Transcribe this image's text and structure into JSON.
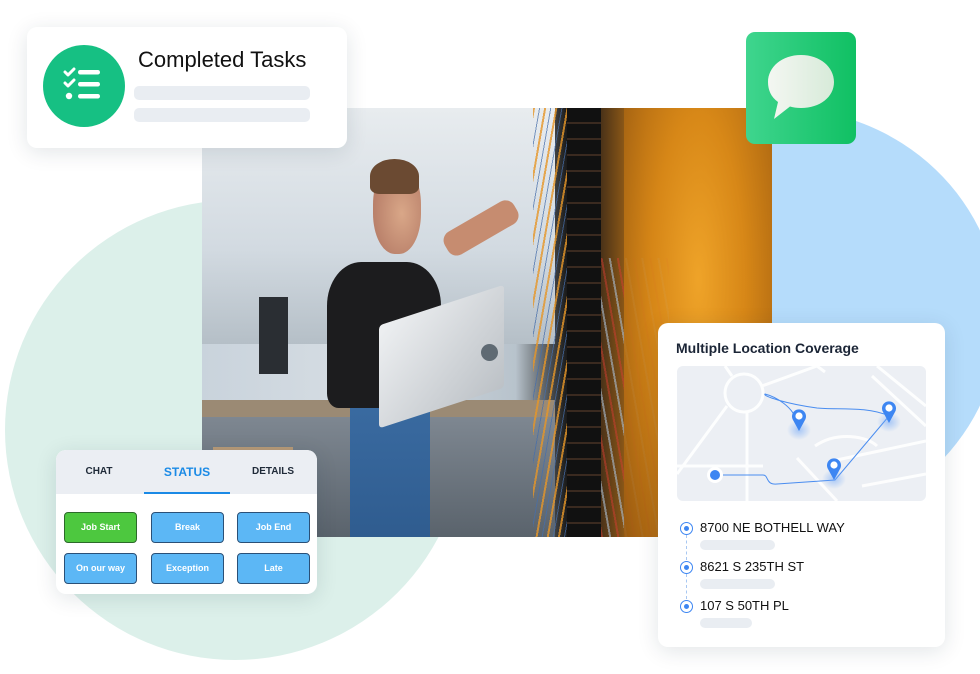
{
  "tasks_card": {
    "title": "Completed Tasks",
    "icon": "checklist-icon",
    "icon_color": "#16c083"
  },
  "chat_tile": {
    "icon": "chat-bubble-icon",
    "gradient": [
      "#3fd58e",
      "#10c063"
    ]
  },
  "photo": {
    "description": "Technician holding a laptop working on a server rack with orange network cables"
  },
  "status_card": {
    "tabs": [
      {
        "label": "CHAT",
        "active": false
      },
      {
        "label": "STATUS",
        "active": true
      },
      {
        "label": "DETAILS",
        "active": false
      }
    ],
    "buttons": [
      {
        "label": "Job Start",
        "active": true
      },
      {
        "label": "Break",
        "active": false
      },
      {
        "label": "Job End",
        "active": false
      },
      {
        "label": "On our way",
        "active": false
      },
      {
        "label": "Exception",
        "active": false
      },
      {
        "label": "Late",
        "active": false
      }
    ],
    "colors": {
      "accent": "#1a8ae6",
      "button": "#5cb7f5",
      "active_button": "#4dc83f"
    }
  },
  "location_card": {
    "title": "Multiple Location Coverage",
    "locations": [
      {
        "address": "8700 NE BOTHELL WAY"
      },
      {
        "address": "8621 S 235TH ST"
      },
      {
        "address": "107 S 50TH PL"
      }
    ],
    "marker_color": "#3d86f2"
  },
  "background": {
    "mint_circle": "#dcf0ea",
    "blue_circle": "#b5dcfb"
  }
}
